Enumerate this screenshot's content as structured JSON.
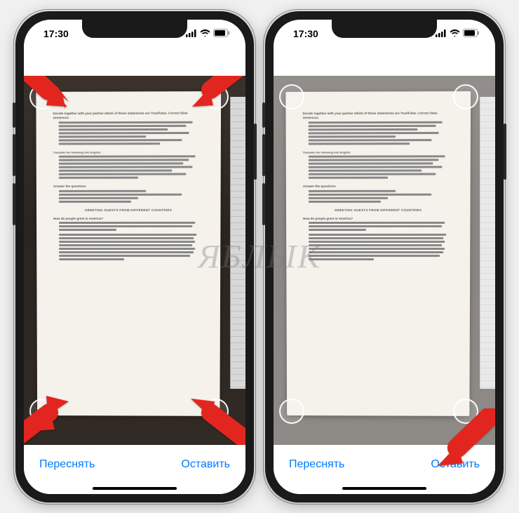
{
  "status": {
    "time": "17:30",
    "signal_icon": "signal-icon",
    "wifi_icon": "wifi-icon",
    "battery_icon": "battery-icon"
  },
  "left_phone": {
    "retake_label": "Переснять",
    "keep_label": "Оставить"
  },
  "right_phone": {
    "retake_label": "Переснять",
    "keep_label": "Оставить"
  },
  "document": {
    "headings": [
      "Decide together with your partner which of these statements are True/False. Correct false sentences.",
      "GREETING GUESTS FROM DIFFERENT COUNTRIES",
      "Answer the questions",
      "How do people greet in America?"
    ]
  },
  "colors": {
    "ios_blue": "#007aff",
    "arrow_red": "#e2261f"
  },
  "watermark": "ЯБЛЫК"
}
